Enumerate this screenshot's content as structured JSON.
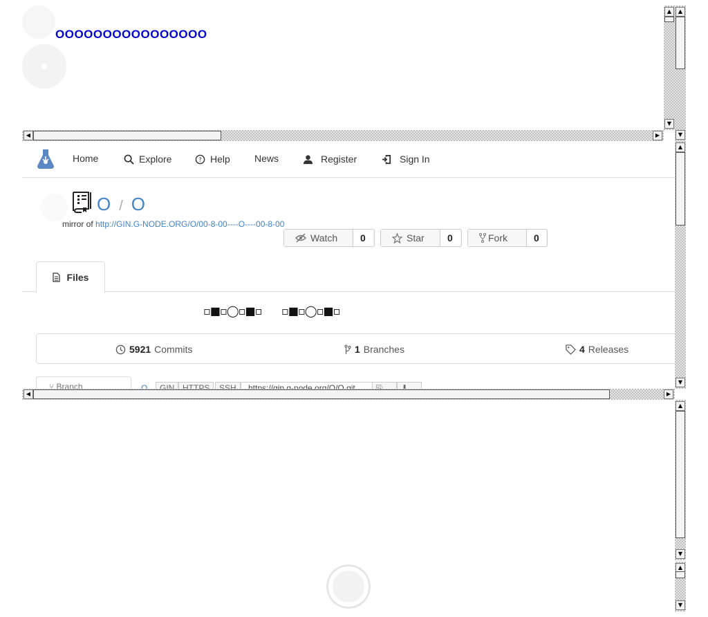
{
  "frame1": {
    "o_row": "OOOOOOOOOOOOOOOO"
  },
  "nav": {
    "home": "Home",
    "explore": "Explore",
    "help": "Help",
    "news": "News",
    "register": "Register",
    "sign_in": "Sign In"
  },
  "repo": {
    "owner": "O",
    "separator": "/",
    "name": "O",
    "mirror_prefix": "mirror of",
    "mirror_url": "http://GIN.G-NODE.ORG/O/00-8-00----O----00-8-00",
    "watch_label": "Watch",
    "watch_count": "0",
    "star_label": "Star",
    "star_count": "0",
    "fork_label": "Fork",
    "fork_count": "0",
    "files_tab": "Files",
    "glyph_row_1": "▫■▫◯▫■▫",
    "glyph_row_2": "▫■▫◯▫■▫",
    "commits_count": "5921",
    "commits_label": "Commits",
    "branches_count": "1",
    "branches_label": "Branches",
    "releases_count": "4",
    "releases_label": "Releases",
    "branch_label": "Branch",
    "clone_link": "O",
    "clone_gin": "GIN",
    "clone_https": "HTTPS",
    "clone_ssh": "SSH",
    "clone_url": "https://gin.g-node.org/O/O.git"
  },
  "colors": {
    "link": "#4183c4",
    "o_row": "#0000cc",
    "logo": "#5b88c4"
  }
}
